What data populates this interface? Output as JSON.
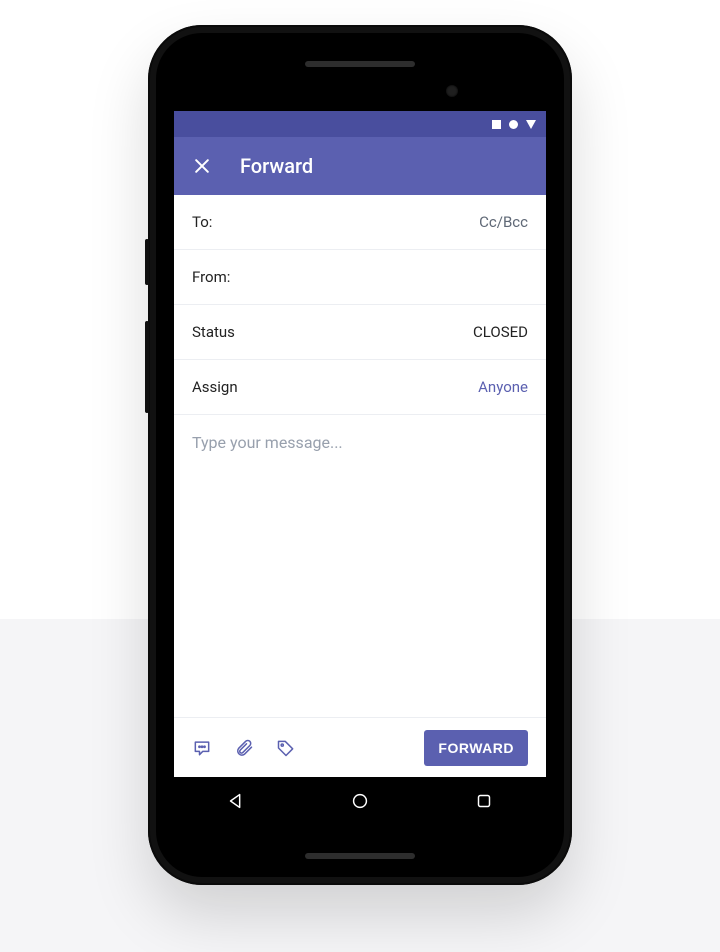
{
  "app_bar": {
    "title": "Forward"
  },
  "fields": {
    "to_label": "To:",
    "ccbcc_label": "Cc/Bcc",
    "from_label": "From:",
    "status_label": "Status",
    "status_value": "CLOSED",
    "assign_label": "Assign",
    "assign_value": "Anyone"
  },
  "message": {
    "placeholder": "Type your message..."
  },
  "toolbar": {
    "forward_button": "FORWARD"
  },
  "colors": {
    "primary": "#5b60b0",
    "primary_dark": "#494e9e"
  }
}
